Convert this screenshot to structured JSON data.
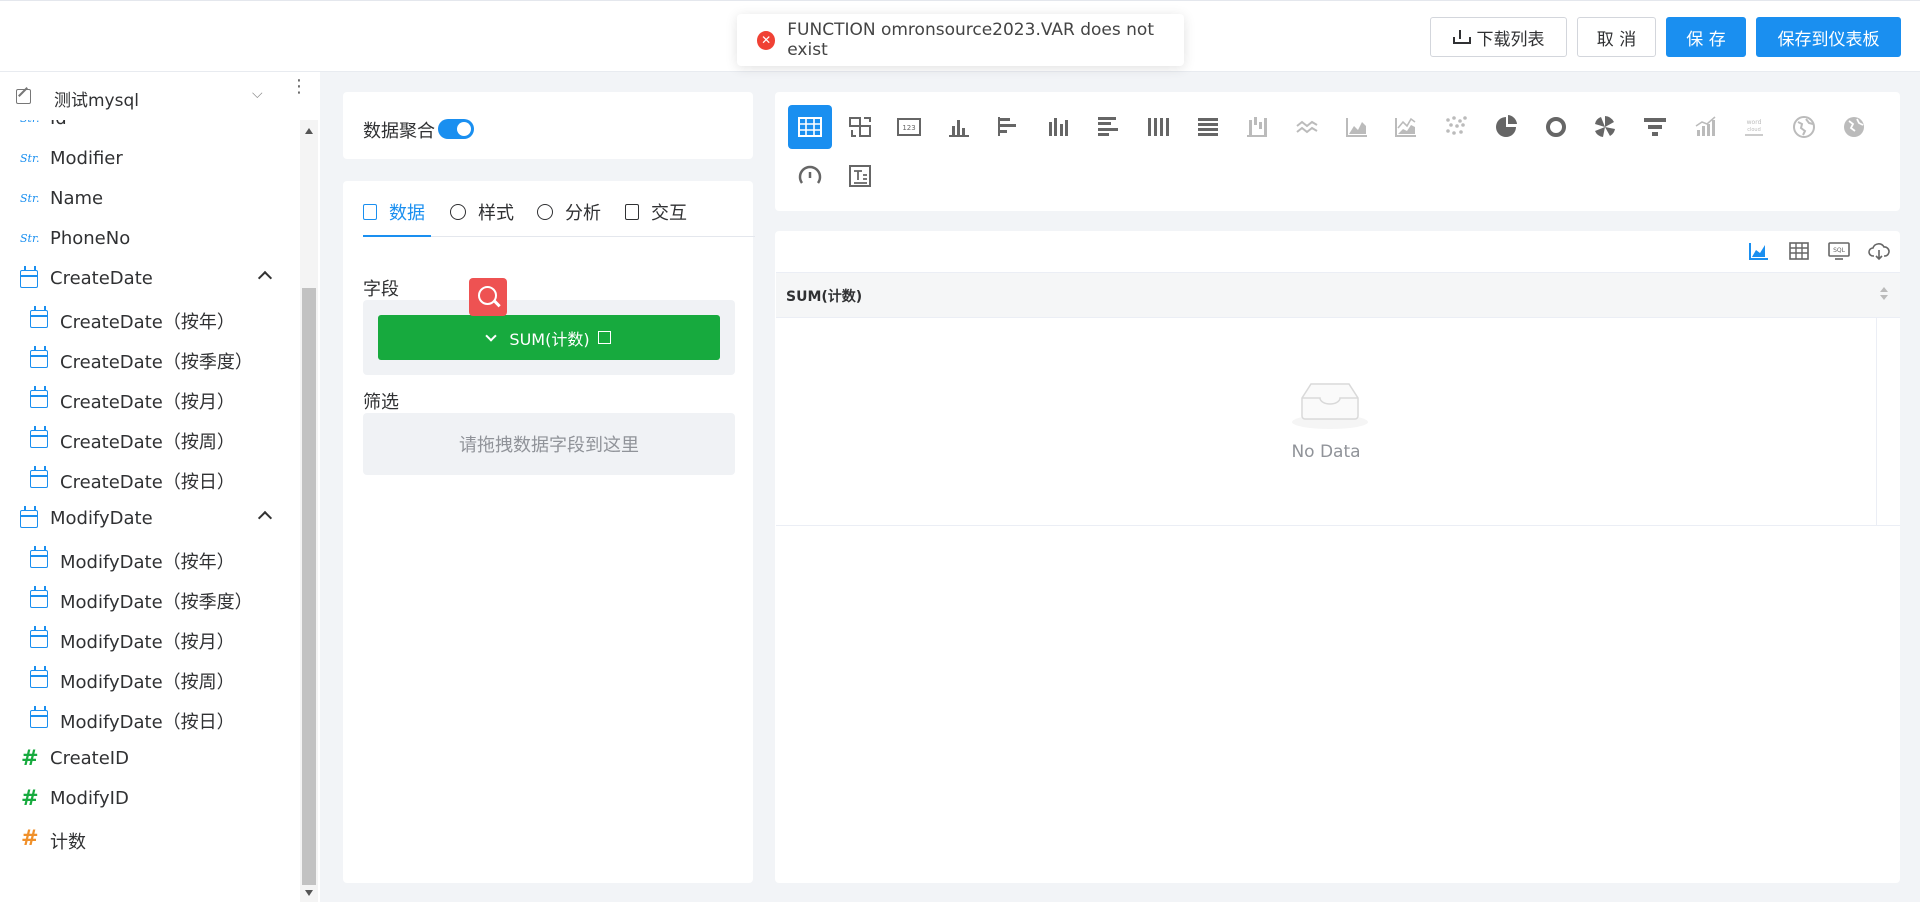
{
  "toolbar": {
    "download_label": "下载列表",
    "cancel_label": "取 消",
    "save_label": "保 存",
    "save_to_dashboard_label": "保存到仪表板"
  },
  "toast": {
    "message": "FUNCTION omronsource2023.VAR does not exist",
    "type": "error"
  },
  "datasource": {
    "name": "测试mysql"
  },
  "fields": [
    {
      "label": "Id",
      "type": "str"
    },
    {
      "label": "Modifier",
      "type": "str"
    },
    {
      "label": "Name",
      "type": "str"
    },
    {
      "label": "PhoneNo",
      "type": "str"
    },
    {
      "label": "CreateDate",
      "type": "date",
      "expanded": true
    },
    {
      "label": "CreateDate（按年）",
      "type": "date-child"
    },
    {
      "label": "CreateDate（按季度）",
      "type": "date-child"
    },
    {
      "label": "CreateDate（按月）",
      "type": "date-child"
    },
    {
      "label": "CreateDate（按周）",
      "type": "date-child"
    },
    {
      "label": "CreateDate（按日）",
      "type": "date-child"
    },
    {
      "label": "ModifyDate",
      "type": "date",
      "expanded": true
    },
    {
      "label": "ModifyDate（按年）",
      "type": "date-child"
    },
    {
      "label": "ModifyDate（按季度）",
      "type": "date-child"
    },
    {
      "label": "ModifyDate（按月）",
      "type": "date-child"
    },
    {
      "label": "ModifyDate（按周）",
      "type": "date-child"
    },
    {
      "label": "ModifyDate（按日）",
      "type": "date-child"
    },
    {
      "label": "CreateID",
      "type": "number"
    },
    {
      "label": "ModifyID",
      "type": "number"
    },
    {
      "label": "计数",
      "type": "count"
    }
  ],
  "config": {
    "aggregate_label": "数据聚合",
    "aggregate_on": true,
    "tabs": [
      {
        "label": "数据",
        "active": true
      },
      {
        "label": "样式",
        "active": false
      },
      {
        "label": "分析",
        "active": false
      },
      {
        "label": "交互",
        "active": false
      }
    ],
    "fields_label": "字段",
    "field_chip": "SUM(计数)",
    "filter_label": "筛选",
    "filter_placeholder": "请拖拽数据字段到这里"
  },
  "chart_types": [
    "table",
    "pivot-table",
    "kpi-card",
    "column",
    "bar",
    "grouped-column",
    "grouped-bar",
    "stacked-column",
    "stacked-bar",
    "waterfall",
    "line",
    "area",
    "stacked-area",
    "scatter",
    "pie",
    "donut",
    "rose",
    "funnel",
    "bar-line",
    "word-cloud",
    "map",
    "globe",
    "gauge",
    "text"
  ],
  "table": {
    "column_header": "SUM(计数)",
    "empty_text": "No Data"
  },
  "colors": {
    "primary": "#1a8ff0",
    "success": "#17aa3e",
    "danger": "#f04134"
  }
}
